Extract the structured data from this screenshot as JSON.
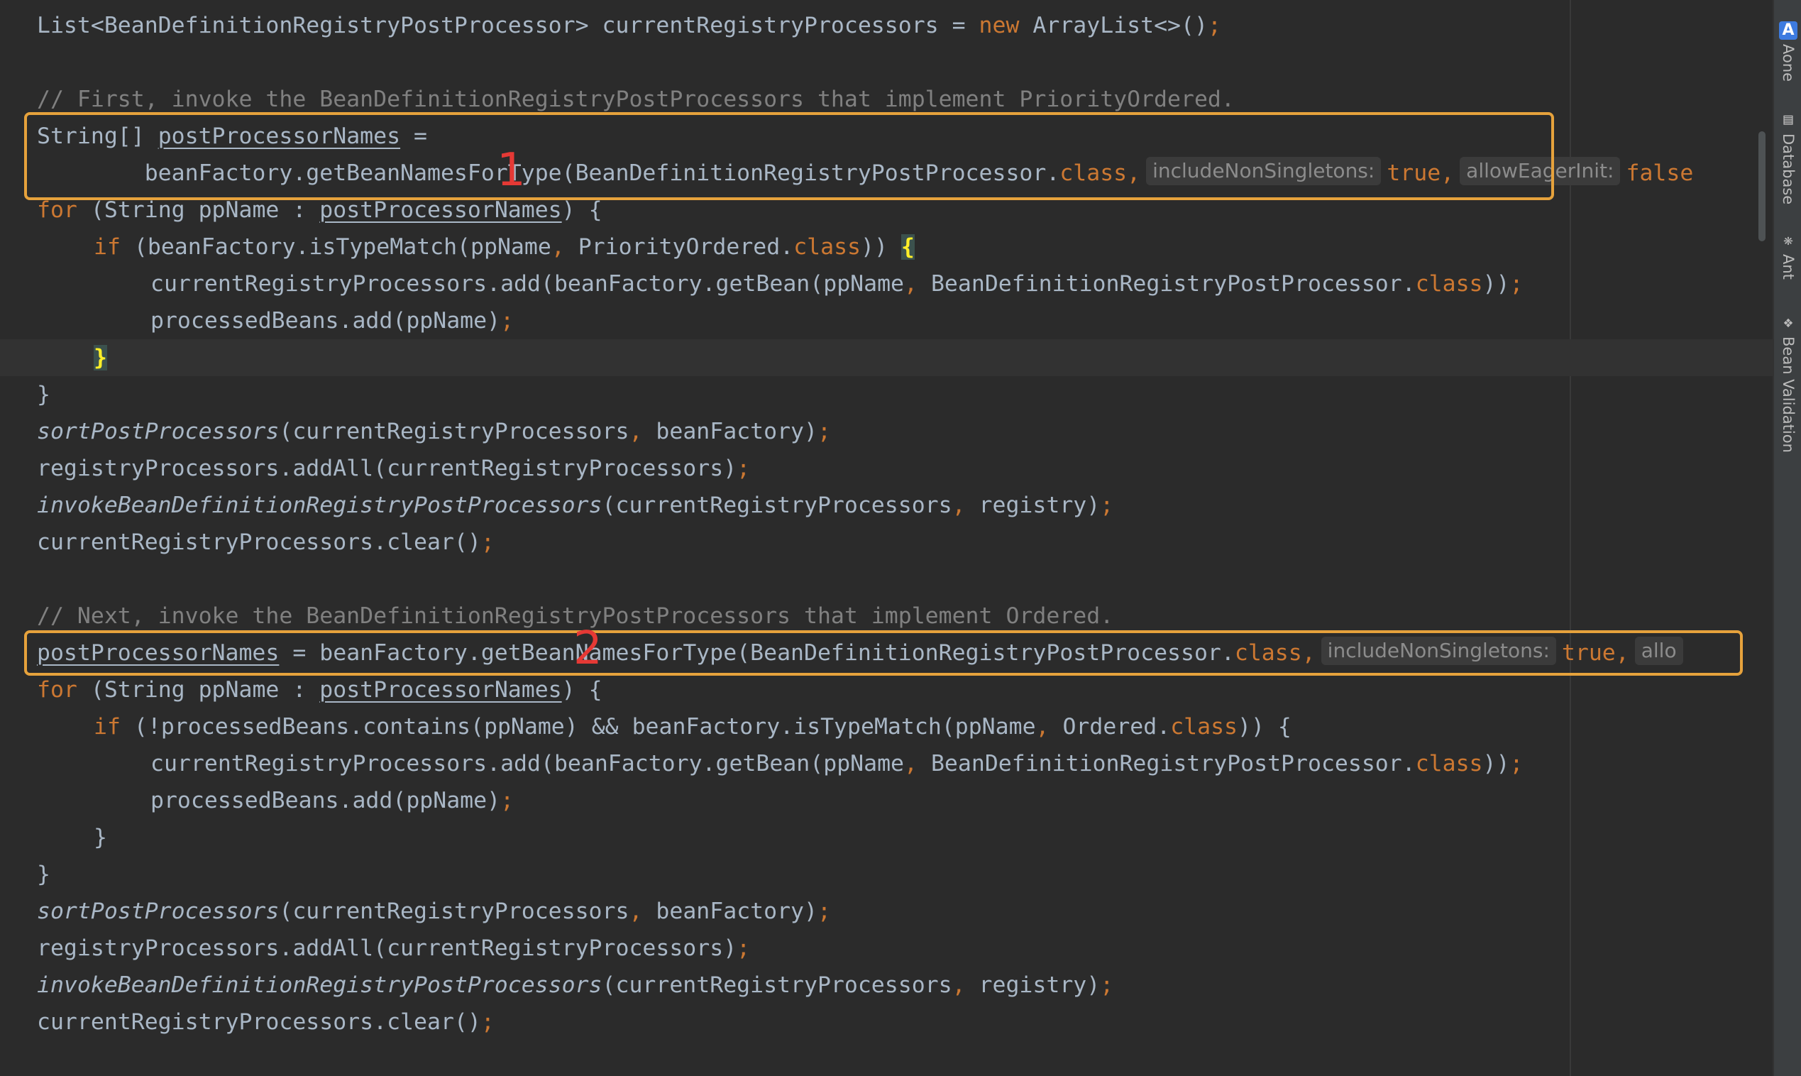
{
  "code": {
    "l1": {
      "p1": "List<BeanDefinitionRegistryPostProcessor> currentRegistryProcessors = ",
      "kw": "new",
      "p2": " ArrayList<>()",
      "semi": ";"
    },
    "l3": {
      "comment": "// First, invoke the BeanDefinitionRegistryPostProcessors that implement PriorityOrdered."
    },
    "l4": {
      "p1": "String[] ",
      "var": "postProcessorNames",
      "p2": " ="
    },
    "l5": {
      "p1": "        beanFactory.getBeanNamesForType(BeanDefinitionRegistryPostProcessor.",
      "kw": "class",
      "comma": ",",
      "hint1": "includeNonSingletons:",
      "val1": "true",
      "comma2": ",",
      "hint2": "allowEagerInit:",
      "val2": "false"
    },
    "l6": {
      "kw": "for",
      "p1": " (String ppName : ",
      "var": "postProcessorNames",
      "p2": ") {"
    },
    "l7": {
      "kw": "if",
      "p1": " (beanFactory.isTypeMatch(ppName",
      "comma": ",",
      "p2": " PriorityOrdered.",
      "kw2": "class",
      "p3": ")) ",
      "brace": "{"
    },
    "l8": {
      "p1": "currentRegistryProcessors.add(beanFactory.getBean(ppName",
      "comma": ",",
      "p2": " BeanDefinitionRegistryPostProcessor.",
      "kw": "class",
      "p3": "))",
      "semi": ";"
    },
    "l9": {
      "p1": "processedBeans.add(ppName)",
      "semi": ";"
    },
    "l10": {
      "brace": "}"
    },
    "l11": {
      "p1": "}"
    },
    "l12": {
      "fn": "sortPostProcessors",
      "p1": "(currentRegistryProcessors",
      "comma": ",",
      "p2": " beanFactory)",
      "semi": ";"
    },
    "l13": {
      "p1": "registryProcessors.addAll(currentRegistryProcessors)",
      "semi": ";"
    },
    "l14": {
      "fn": "invokeBeanDefinitionRegistryPostProcessors",
      "p1": "(currentRegistryProcessors",
      "comma": ",",
      "p2": " registry)",
      "semi": ";"
    },
    "l15": {
      "p1": "currentRegistryProcessors.clear()",
      "semi": ";"
    },
    "l17": {
      "comment": "// Next, invoke the BeanDefinitionRegistryPostProcessors that implement Ordered."
    },
    "l18": {
      "var": "postProcessorNames",
      "p1": " = beanFactory.getBeanNamesForType(BeanDefinitionRegistryPostProcessor.",
      "kw": "class",
      "comma": ",",
      "hint1": "includeNonSingletons:",
      "val1": "true",
      "comma2": ",",
      "hint2": "allo"
    },
    "l19": {
      "kw": "for",
      "p1": " (String ppName : ",
      "var": "postProcessorNames",
      "p2": ") {"
    },
    "l20": {
      "kw": "if",
      "p1": " (!processedBeans.contains(ppName) && beanFactory.isTypeMatch(ppName",
      "comma": ",",
      "p2": " Ordered.",
      "kw2": "class",
      "p3": ")) {"
    },
    "l21": {
      "p1": "currentRegistryProcessors.add(beanFactory.getBean(ppName",
      "comma": ",",
      "p2": " BeanDefinitionRegistryPostProcessor.",
      "kw": "class",
      "p3": "))",
      "semi": ";"
    },
    "l22": {
      "p1": "processedBeans.add(ppName)",
      "semi": ";"
    },
    "l23": {
      "p1": "}"
    },
    "l24": {
      "p1": "}"
    },
    "l25": {
      "fn": "sortPostProcessors",
      "p1": "(currentRegistryProcessors",
      "comma": ",",
      "p2": " beanFactory)",
      "semi": ";"
    },
    "l26": {
      "p1": "registryProcessors.addAll(currentRegistryProcessors)",
      "semi": ";"
    },
    "l27": {
      "fn": "invokeBeanDefinitionRegistryPostProcessors",
      "p1": "(currentRegistryProcessors",
      "comma": ",",
      "p2": " registry)",
      "semi": ";"
    },
    "l28": {
      "p1": "currentRegistryProcessors.clear()",
      "semi": ";"
    }
  },
  "annotations": {
    "marker1": "1",
    "marker2": "2"
  },
  "tool_windows": [
    {
      "icon": "A",
      "label": "Aone"
    },
    {
      "icon": "database-icon",
      "label": "Database"
    },
    {
      "icon": "ant-icon",
      "label": "Ant"
    },
    {
      "icon": "bean-icon",
      "label": "Bean Validation"
    }
  ],
  "colors": {
    "keyword": "#cc7832",
    "comment": "#808080",
    "text": "#a9b7c6",
    "highlight_box": "#e6a23c",
    "marker": "#e53935"
  }
}
